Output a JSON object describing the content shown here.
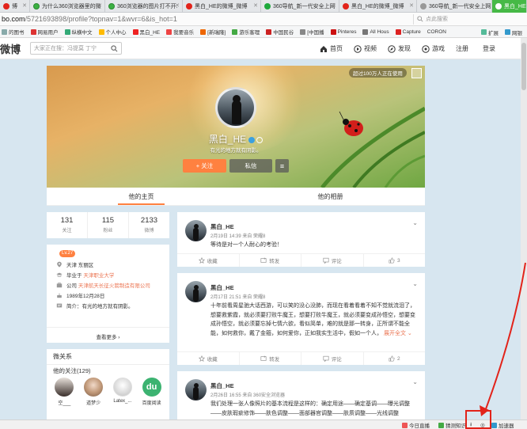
{
  "tabs": [
    {
      "label": "博",
      "fav": "red"
    },
    {
      "label": "为什么360浏览器里的微",
      "fav": "green"
    },
    {
      "label": "360浏览器的图片打不开.",
      "fav": "green"
    },
    {
      "label": "黑白_HE的微博_微博",
      "fav": "red"
    },
    {
      "label": "360导航_新一代安全上网",
      "fav": "blue360"
    },
    {
      "label": "黑白_HE的微博_微博",
      "fav": "red"
    },
    {
      "label": "360导航_新一代安全上网",
      "fav": "gray"
    },
    {
      "label": "黑白_HE",
      "fav": "red"
    }
  ],
  "address": {
    "host": "bo.com",
    "path": "/5721693898/profile?topnav=1&wvr=6&is_hot=1"
  },
  "search_placeholder": "点此搜索",
  "bookmarks": [
    "的图书",
    "网易用户",
    "纵横中文",
    "个人中心",
    "黑白_HE",
    "我要音乐",
    "[新瑞隆]",
    "游乐客理",
    "中国民谷",
    "[中国播",
    "Pinteres",
    "All Hous",
    "Capture",
    "CORON"
  ],
  "bookmarks_right": [
    "扩展",
    "网银"
  ],
  "weibo": {
    "logo": "微博",
    "search_placeholder": "大家正在搜：冯提莫 丁宁",
    "nav": [
      "首页",
      "视频",
      "发现",
      "游戏"
    ],
    "auth": [
      "注册",
      "登录"
    ]
  },
  "cover": {
    "badge": "超过100万人正在使用"
  },
  "profile": {
    "nickname": "黑白_HE",
    "intro": "有光的地方就有阴影。",
    "follow": "+ 关注",
    "message": "私信",
    "more": "≡"
  },
  "profile_tabs": [
    "他的主页",
    "他的相册"
  ],
  "stats": [
    {
      "num": "131",
      "label": "关注"
    },
    {
      "num": "115",
      "label": "粉丝"
    },
    {
      "num": "2133",
      "label": "微博"
    }
  ],
  "info": {
    "level": "Lv.27",
    "location": "天津 东丽区",
    "school_prefix": "毕业于",
    "school": "天津职业大学",
    "company_prefix": "公司",
    "company": "天津航天长征火箭制造有限公司",
    "birthday": "1989年12月28日",
    "intro_prefix": "简介：",
    "intro": "有光的地方就有阴影。",
    "more": "查看更多 ›"
  },
  "relations": {
    "title": "微关系",
    "sub": "他的关注(129)",
    "follows": [
      "空___",
      "道梦少",
      "Latex_...",
      "百度阅读"
    ]
  },
  "posts": [
    {
      "name": "黑白_HE",
      "meta": "2月19日 14:39 来自 荣耀8",
      "text": "等待是对一个人耐心的考验！",
      "actions": [
        "收藏",
        "转发",
        "评论",
        "3"
      ]
    },
    {
      "name": "黑白_HE",
      "meta": "2月17日 21:51 来自 荣耀8",
      "text": "十年前看周星驰大话西游，可以笑的没心没肺，而现在看着看着不知不觉就流泪了，想要救紫霞，就必须要打败牛魔王，想要打败牛魔王，就必须要变成孙悟空，想要变成孙悟空，就必须要忘掉七情六欲，看似简单，难的就是那一转身，正所谓不能全能，如何救你，戴了金箍，如何爱你，正如我实生活中，假如一个人，",
      "expand": "展开全文 ⌄",
      "actions": [
        "收藏",
        "转发",
        "评论",
        "2"
      ]
    },
    {
      "name": "黑白_HE",
      "meta": "2月26日 16:55 来自 360安全浏览器",
      "text": "我们处理一张人像照片的基本流程是这样的：确定用途——确定基调——曝光调整——皮肤瑕疵修饰——肤色调整——面部器官调整——肤质调整——光线调整",
      "actions": [
        "收藏",
        "转发",
        "评论",
        ""
      ]
    }
  ],
  "statusbar": [
    "今日直播",
    "猜测知识",
    "加速器"
  ],
  "colors": {
    "accent": "#ff8140",
    "link": "#eb7350",
    "tab_active": "#46b946",
    "highlight": "#e2231a"
  }
}
